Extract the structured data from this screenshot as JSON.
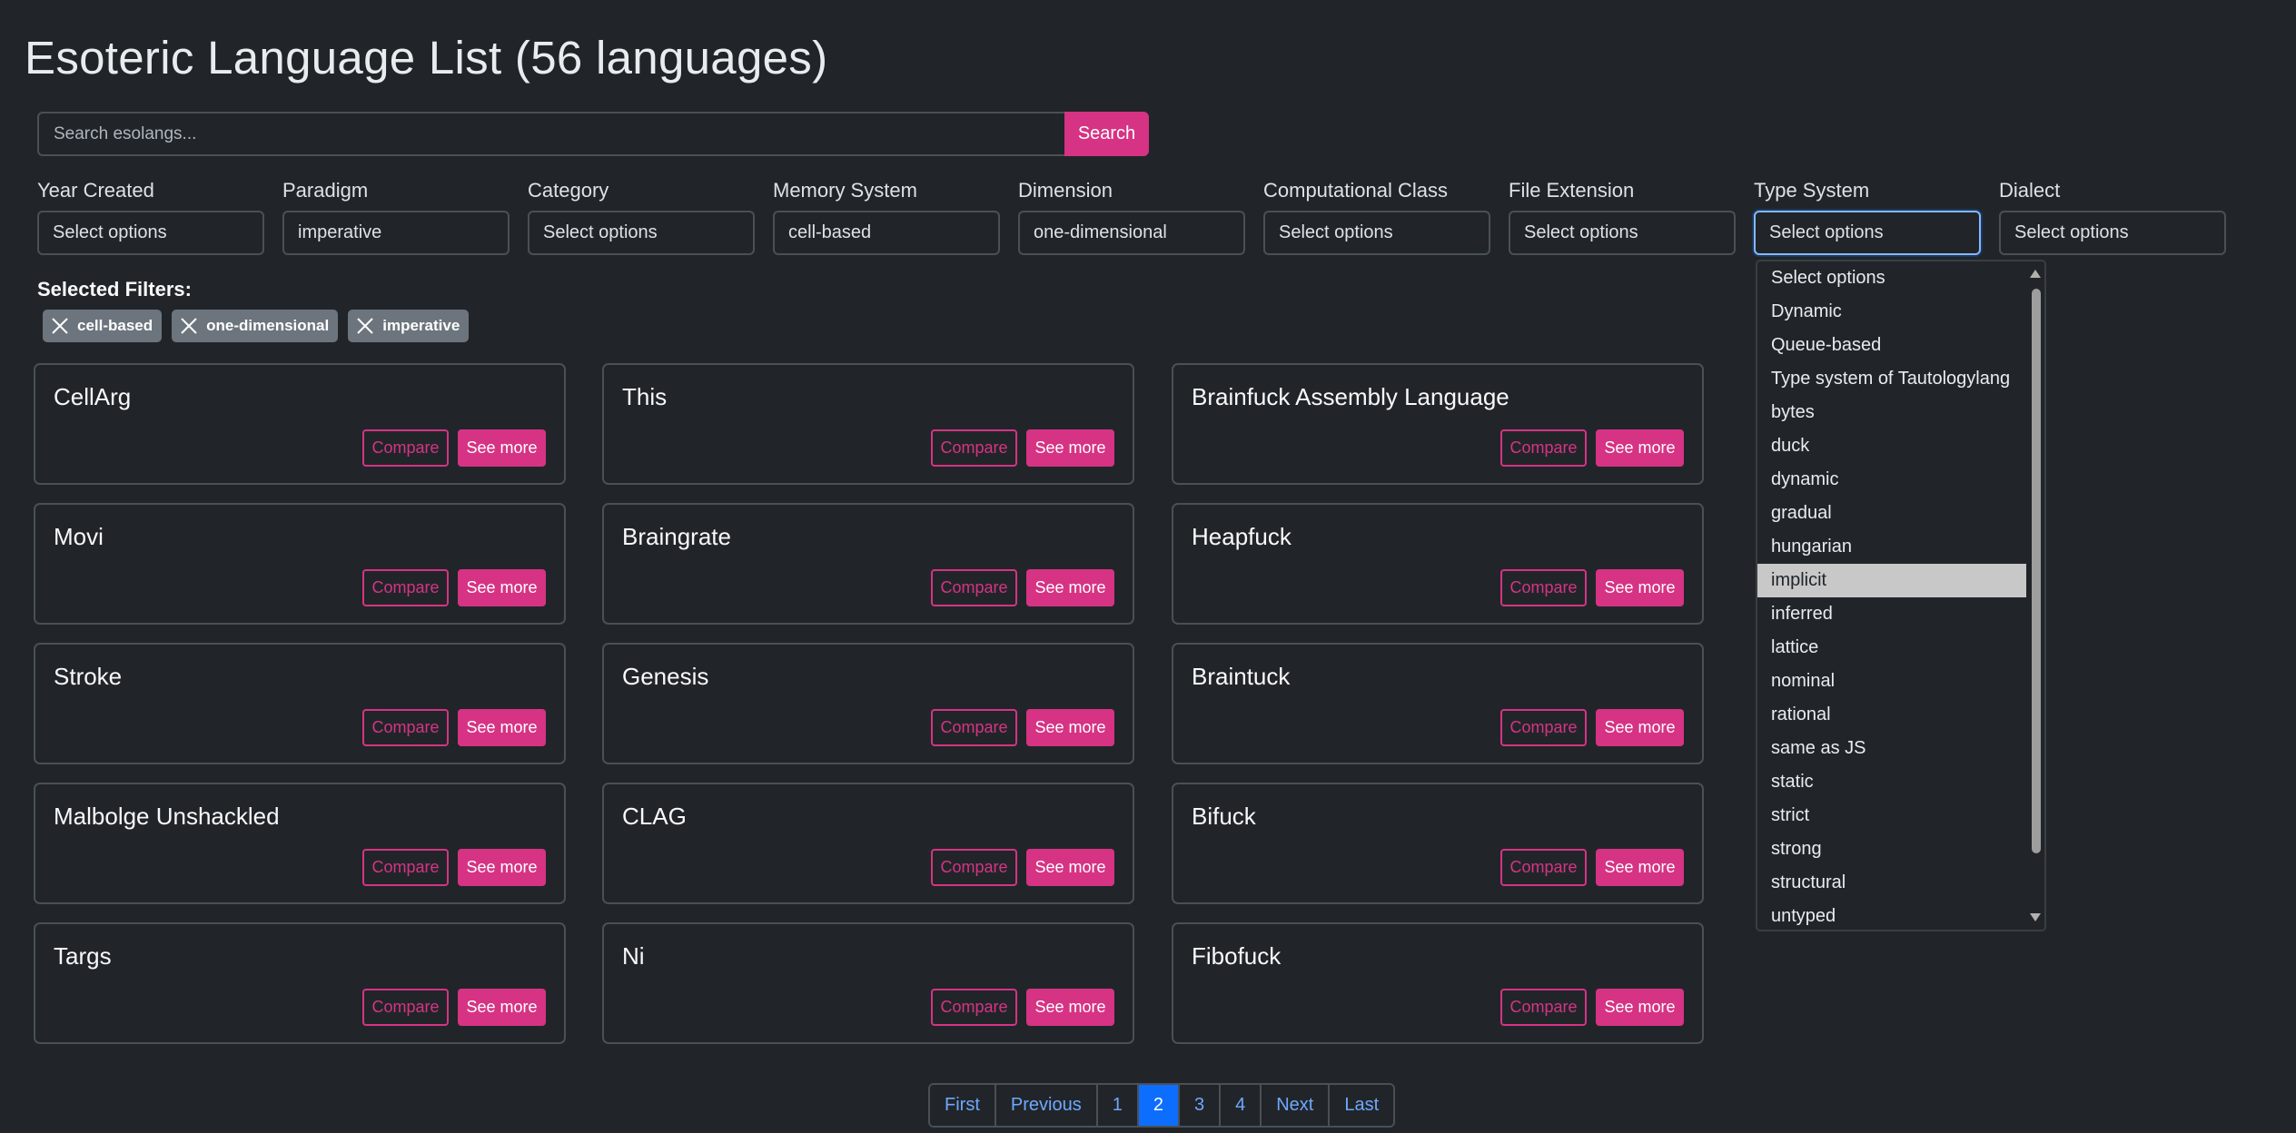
{
  "page": {
    "title": "Esoteric Language List (56 languages)"
  },
  "search": {
    "placeholder": "Search esolangs...",
    "button": "Search"
  },
  "filters": [
    {
      "label": "Year Created",
      "value": "Select options"
    },
    {
      "label": "Paradigm",
      "value": "imperative"
    },
    {
      "label": "Category",
      "value": "Select options"
    },
    {
      "label": "Memory System",
      "value": "cell-based"
    },
    {
      "label": "Dimension",
      "value": "one-dimensional"
    },
    {
      "label": "Computational Class",
      "value": "Select options"
    },
    {
      "label": "File Extension",
      "value": "Select options"
    },
    {
      "label": "Type System",
      "value": "Select options"
    },
    {
      "label": "Dialect",
      "value": "Select options"
    }
  ],
  "selected_filters": {
    "label": "Selected Filters:",
    "chips": [
      "cell-based",
      "one-dimensional",
      "imperative"
    ]
  },
  "card_buttons": {
    "compare": "Compare",
    "see_more": "See more"
  },
  "languages": [
    "CellArg",
    "This",
    "Brainfuck Assembly Language",
    "Movi",
    "Braingrate",
    "Heapfuck",
    "Stroke",
    "Genesis",
    "Braintuck",
    "Malbolge Unshackled",
    "CLAG",
    "Bifuck",
    "Targs",
    "Ni",
    "Fibofuck"
  ],
  "type_system_dropdown": {
    "options": [
      "Select options",
      "Dynamic",
      "Queue-based",
      "Type system of Tautologylang",
      "bytes",
      "duck",
      "dynamic",
      "gradual",
      "hungarian",
      "implicit",
      "inferred",
      "lattice",
      "nominal",
      "rational",
      "same as JS",
      "static",
      "strict",
      "strong",
      "structural",
      "untyped"
    ],
    "highlighted": "implicit"
  },
  "pagination": {
    "items": [
      "First",
      "Previous",
      "1",
      "2",
      "3",
      "4",
      "Next",
      "Last"
    ],
    "current": "2"
  },
  "colors": {
    "background": "#212529",
    "accent": "#d63384",
    "primary": "#0d6efd",
    "chip": "#6c757d"
  }
}
